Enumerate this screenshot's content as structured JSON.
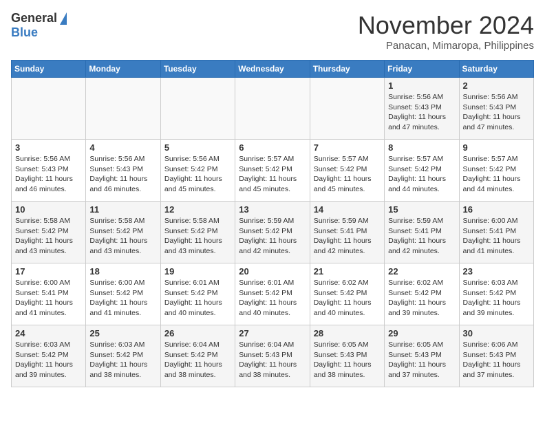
{
  "header": {
    "logo_general": "General",
    "logo_blue": "Blue",
    "month_title": "November 2024",
    "location": "Panacan, Mimaropa, Philippines"
  },
  "weekdays": [
    "Sunday",
    "Monday",
    "Tuesday",
    "Wednesday",
    "Thursday",
    "Friday",
    "Saturday"
  ],
  "weeks": [
    [
      {
        "day": "",
        "info": ""
      },
      {
        "day": "",
        "info": ""
      },
      {
        "day": "",
        "info": ""
      },
      {
        "day": "",
        "info": ""
      },
      {
        "day": "",
        "info": ""
      },
      {
        "day": "1",
        "info": "Sunrise: 5:56 AM\nSunset: 5:43 PM\nDaylight: 11 hours\nand 47 minutes."
      },
      {
        "day": "2",
        "info": "Sunrise: 5:56 AM\nSunset: 5:43 PM\nDaylight: 11 hours\nand 47 minutes."
      }
    ],
    [
      {
        "day": "3",
        "info": "Sunrise: 5:56 AM\nSunset: 5:43 PM\nDaylight: 11 hours\nand 46 minutes."
      },
      {
        "day": "4",
        "info": "Sunrise: 5:56 AM\nSunset: 5:43 PM\nDaylight: 11 hours\nand 46 minutes."
      },
      {
        "day": "5",
        "info": "Sunrise: 5:56 AM\nSunset: 5:42 PM\nDaylight: 11 hours\nand 45 minutes."
      },
      {
        "day": "6",
        "info": "Sunrise: 5:57 AM\nSunset: 5:42 PM\nDaylight: 11 hours\nand 45 minutes."
      },
      {
        "day": "7",
        "info": "Sunrise: 5:57 AM\nSunset: 5:42 PM\nDaylight: 11 hours\nand 45 minutes."
      },
      {
        "day": "8",
        "info": "Sunrise: 5:57 AM\nSunset: 5:42 PM\nDaylight: 11 hours\nand 44 minutes."
      },
      {
        "day": "9",
        "info": "Sunrise: 5:57 AM\nSunset: 5:42 PM\nDaylight: 11 hours\nand 44 minutes."
      }
    ],
    [
      {
        "day": "10",
        "info": "Sunrise: 5:58 AM\nSunset: 5:42 PM\nDaylight: 11 hours\nand 43 minutes."
      },
      {
        "day": "11",
        "info": "Sunrise: 5:58 AM\nSunset: 5:42 PM\nDaylight: 11 hours\nand 43 minutes."
      },
      {
        "day": "12",
        "info": "Sunrise: 5:58 AM\nSunset: 5:42 PM\nDaylight: 11 hours\nand 43 minutes."
      },
      {
        "day": "13",
        "info": "Sunrise: 5:59 AM\nSunset: 5:42 PM\nDaylight: 11 hours\nand 42 minutes."
      },
      {
        "day": "14",
        "info": "Sunrise: 5:59 AM\nSunset: 5:41 PM\nDaylight: 11 hours\nand 42 minutes."
      },
      {
        "day": "15",
        "info": "Sunrise: 5:59 AM\nSunset: 5:41 PM\nDaylight: 11 hours\nand 42 minutes."
      },
      {
        "day": "16",
        "info": "Sunrise: 6:00 AM\nSunset: 5:41 PM\nDaylight: 11 hours\nand 41 minutes."
      }
    ],
    [
      {
        "day": "17",
        "info": "Sunrise: 6:00 AM\nSunset: 5:41 PM\nDaylight: 11 hours\nand 41 minutes."
      },
      {
        "day": "18",
        "info": "Sunrise: 6:00 AM\nSunset: 5:42 PM\nDaylight: 11 hours\nand 41 minutes."
      },
      {
        "day": "19",
        "info": "Sunrise: 6:01 AM\nSunset: 5:42 PM\nDaylight: 11 hours\nand 40 minutes."
      },
      {
        "day": "20",
        "info": "Sunrise: 6:01 AM\nSunset: 5:42 PM\nDaylight: 11 hours\nand 40 minutes."
      },
      {
        "day": "21",
        "info": "Sunrise: 6:02 AM\nSunset: 5:42 PM\nDaylight: 11 hours\nand 40 minutes."
      },
      {
        "day": "22",
        "info": "Sunrise: 6:02 AM\nSunset: 5:42 PM\nDaylight: 11 hours\nand 39 minutes."
      },
      {
        "day": "23",
        "info": "Sunrise: 6:03 AM\nSunset: 5:42 PM\nDaylight: 11 hours\nand 39 minutes."
      }
    ],
    [
      {
        "day": "24",
        "info": "Sunrise: 6:03 AM\nSunset: 5:42 PM\nDaylight: 11 hours\nand 39 minutes."
      },
      {
        "day": "25",
        "info": "Sunrise: 6:03 AM\nSunset: 5:42 PM\nDaylight: 11 hours\nand 38 minutes."
      },
      {
        "day": "26",
        "info": "Sunrise: 6:04 AM\nSunset: 5:42 PM\nDaylight: 11 hours\nand 38 minutes."
      },
      {
        "day": "27",
        "info": "Sunrise: 6:04 AM\nSunset: 5:43 PM\nDaylight: 11 hours\nand 38 minutes."
      },
      {
        "day": "28",
        "info": "Sunrise: 6:05 AM\nSunset: 5:43 PM\nDaylight: 11 hours\nand 38 minutes."
      },
      {
        "day": "29",
        "info": "Sunrise: 6:05 AM\nSunset: 5:43 PM\nDaylight: 11 hours\nand 37 minutes."
      },
      {
        "day": "30",
        "info": "Sunrise: 6:06 AM\nSunset: 5:43 PM\nDaylight: 11 hours\nand 37 minutes."
      }
    ]
  ]
}
